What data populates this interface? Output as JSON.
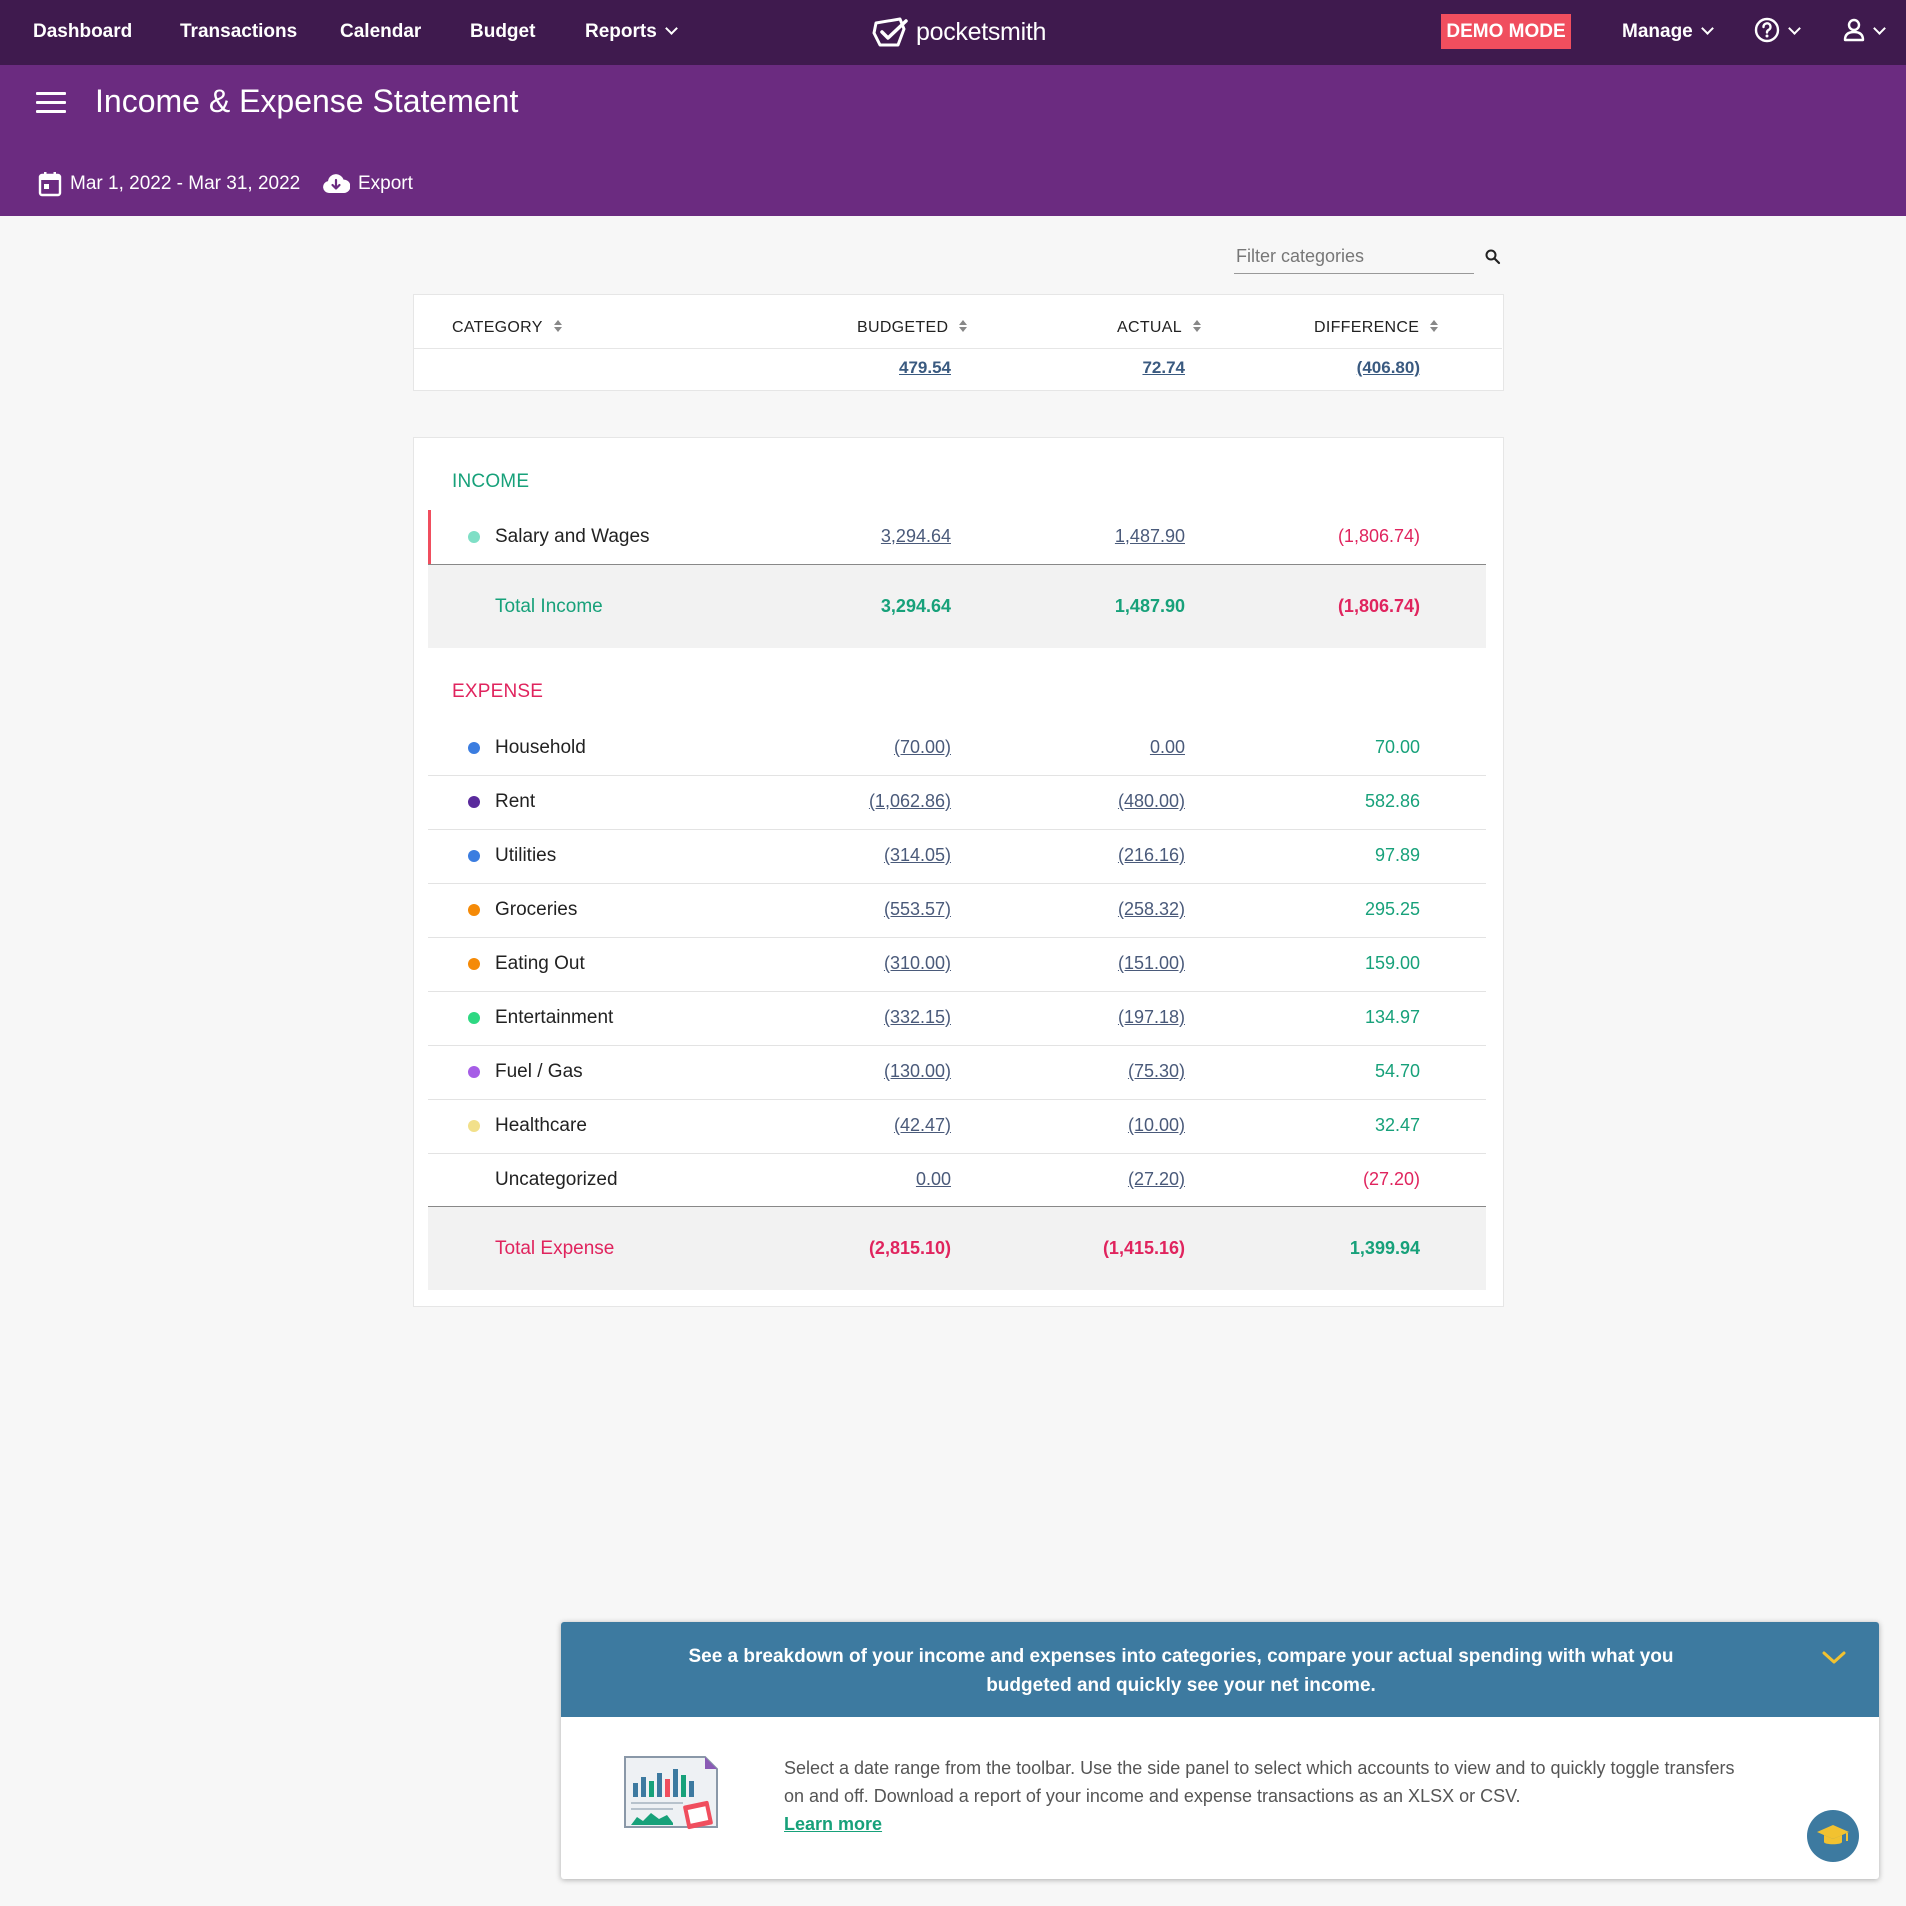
{
  "nav": {
    "items": [
      "Dashboard",
      "Transactions",
      "Calendar",
      "Budget",
      "Reports"
    ],
    "brand": "pocketsmith",
    "demo_badge": "DEMO MODE",
    "manage": "Manage"
  },
  "header": {
    "title": "Income & Expense Statement",
    "date_range": "Mar 1, 2022 - Mar 31, 2022",
    "export": "Export"
  },
  "filter": {
    "placeholder": "Filter categories"
  },
  "columns": {
    "category": "CATEGORY",
    "budgeted": "BUDGETED",
    "actual": "ACTUAL",
    "difference": "DIFFERENCE"
  },
  "net": {
    "budgeted": "479.54",
    "actual": "72.74",
    "difference": "(406.80)"
  },
  "income": {
    "label": "INCOME",
    "rows": [
      {
        "name": "Salary and Wages",
        "color": "#7fdfc6",
        "budgeted": "3,294.64",
        "actual": "1,487.90",
        "difference": "(1,806.74)"
      }
    ],
    "total": {
      "label": "Total Income",
      "budgeted": "3,294.64",
      "actual": "1,487.90",
      "difference": "(1,806.74)"
    }
  },
  "expense": {
    "label": "EXPENSE",
    "rows": [
      {
        "name": "Household",
        "color": "#3b7de0",
        "budgeted": "(70.00)",
        "actual": "0.00",
        "difference": "70.00"
      },
      {
        "name": "Rent",
        "color": "#5a2a9c",
        "budgeted": "(1,062.86)",
        "actual": "(480.00)",
        "difference": "582.86"
      },
      {
        "name": "Utilities",
        "color": "#3b7de0",
        "budgeted": "(314.05)",
        "actual": "(216.16)",
        "difference": "97.89"
      },
      {
        "name": "Groceries",
        "color": "#f58a07",
        "budgeted": "(553.57)",
        "actual": "(258.32)",
        "difference": "295.25"
      },
      {
        "name": "Eating Out",
        "color": "#f58a07",
        "budgeted": "(310.00)",
        "actual": "(151.00)",
        "difference": "159.00"
      },
      {
        "name": "Entertainment",
        "color": "#2ed882",
        "budgeted": "(332.15)",
        "actual": "(197.18)",
        "difference": "134.97"
      },
      {
        "name": "Fuel / Gas",
        "color": "#a65de6",
        "budgeted": "(130.00)",
        "actual": "(75.30)",
        "difference": "54.70"
      },
      {
        "name": "Healthcare",
        "color": "#f2e08a",
        "budgeted": "(42.47)",
        "actual": "(10.00)",
        "difference": "32.47"
      },
      {
        "name": "Uncategorized",
        "color": "",
        "budgeted": "0.00",
        "actual": "(27.20)",
        "difference": "(27.20)"
      }
    ],
    "total": {
      "label": "Total Expense",
      "budgeted": "(2,815.10)",
      "actual": "(1,415.16)",
      "difference": "1,399.94"
    }
  },
  "tip": {
    "headline": "See a breakdown of your income and expenses into categories, compare your actual spending with what you budgeted and quickly see your net income.",
    "body": "Select a date range from the toolbar. Use the side panel to select which accounts to view and to quickly toggle transfers on and off. Download a report of your income and expense transactions as an XLSX or CSV.",
    "link": "Learn more"
  }
}
